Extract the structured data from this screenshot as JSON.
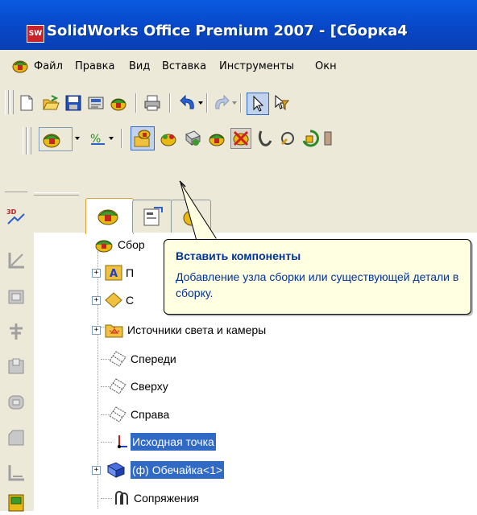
{
  "window": {
    "title": "SolidWorks Office Premium 2007 - [Сборка4",
    "app_icon_text": "SW"
  },
  "menubar": {
    "items": [
      "Файл",
      "Правка",
      "Вид",
      "Вставка",
      "Инструменты",
      "Окн"
    ]
  },
  "toolbar_standard": {
    "icons": [
      "new-document-icon",
      "open-folder-icon",
      "save-icon",
      "print-preview-icon",
      "options-icon",
      "print-icon",
      "undo-icon",
      "redo-icon",
      "select-icon",
      "select-filter-icon"
    ]
  },
  "toolbar_assembly": {
    "icons": [
      "assembly-icon",
      "sketch-icon",
      "insert-component-icon",
      "new-part-icon",
      "new-assembly-icon",
      "mate-icon",
      "move-component-icon",
      "rotate-component-icon",
      "smart-fastener-icon",
      "exploded-view-icon"
    ]
  },
  "feature_manager": {
    "tabs": [
      "feature-manager-tab",
      "property-manager-tab",
      "configuration-manager-tab"
    ],
    "tree": [
      {
        "label": "Сбор",
        "icon": "assembly-icon",
        "expander": false,
        "selected": false
      },
      {
        "label": "П",
        "icon": "annotations-icon",
        "expander": true,
        "selected": false
      },
      {
        "label": "С",
        "icon": "sensor-icon",
        "expander": true,
        "selected": false
      },
      {
        "label": "Источники света и камеры",
        "icon": "lights-cameras-icon",
        "expander": true,
        "selected": false
      },
      {
        "label": "Спереди",
        "icon": "plane-icon",
        "expander": false,
        "selected": false
      },
      {
        "label": "Сверху",
        "icon": "plane-icon",
        "expander": false,
        "selected": false
      },
      {
        "label": "Справа",
        "icon": "plane-icon",
        "expander": false,
        "selected": false
      },
      {
        "label": "Исходная точка",
        "icon": "origin-icon",
        "expander": false,
        "selected": true
      },
      {
        "label": "(ф) Обечайка<1>",
        "icon": "part-icon",
        "expander": true,
        "selected": true
      },
      {
        "label": "Сопряжения",
        "icon": "mates-icon",
        "expander": false,
        "selected": false
      }
    ]
  },
  "tooltip": {
    "title": "Вставить компоненты",
    "body": "Добавление узла сборки или существующей детали  в сборку."
  },
  "colors": {
    "titlebar": "#0747c7",
    "toolbar_bg": "#ece9d8",
    "selection": "#316ac5",
    "tooltip_bg": "#ffffe1",
    "tooltip_text": "#003399"
  }
}
